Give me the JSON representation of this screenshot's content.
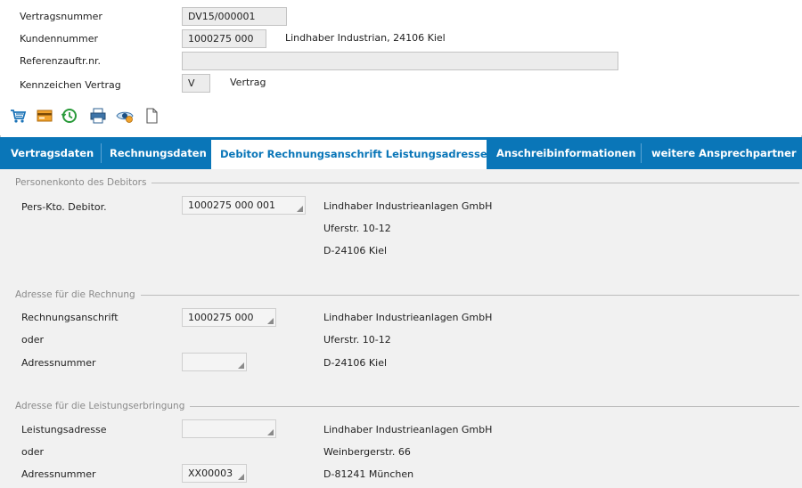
{
  "header": {
    "rows": [
      {
        "label": "Vertragsnummer",
        "value": "DV15/000001"
      },
      {
        "label": "Kundennummer",
        "value": "1000275 000",
        "extra": "Lindhaber Industrian, 24106 Kiel"
      },
      {
        "label": "Referenzauftr.nr.",
        "value": ""
      },
      {
        "label": "Kennzeichen Vertrag",
        "value": "V",
        "extra": "Vertrag"
      }
    ]
  },
  "toolbar": {
    "icons": [
      "cart-icon",
      "card-icon",
      "history-icon",
      "print-icon",
      "view-icon",
      "document-icon"
    ]
  },
  "tabs": [
    {
      "label": "Vertragsdaten",
      "active": false
    },
    {
      "label": "Rechnungsdaten",
      "active": false
    },
    {
      "label": "Debitor Rechnungsanschrift Leistungsadresse",
      "active": true
    },
    {
      "label": "Anschreibinformationen",
      "active": false
    },
    {
      "label": "weitere Ansprechpartner",
      "active": false
    }
  ],
  "groups": {
    "debitor": {
      "title": "Personenkonto des Debitors",
      "label": "Pers-Kto. Debitor.",
      "value": "1000275 000 001",
      "address": [
        "Lindhaber Industrieanlagen GmbH",
        "Uferstr. 10-12",
        "D-24106 Kiel"
      ]
    },
    "rechnung": {
      "title": "Adresse für die Rechnung",
      "rows": [
        {
          "label": "Rechnungsanschrift",
          "value": "1000275 000"
        },
        {
          "label": "oder"
        },
        {
          "label": "Adressnummer",
          "value": ""
        }
      ],
      "address": [
        "Lindhaber Industrieanlagen GmbH",
        "Uferstr. 10-12",
        "D-24106 Kiel"
      ]
    },
    "leistung": {
      "title": "Adresse für die Leistungserbringung",
      "rows": [
        {
          "label": "Leistungsadresse",
          "value": ""
        },
        {
          "label": "oder"
        },
        {
          "label": "Adressnummer",
          "value": "XX00003"
        }
      ],
      "address": [
        "Lindhaber Industrieanlagen GmbH",
        "Weinbergerstr. 66",
        "D-81241 München"
      ]
    }
  },
  "colors": {
    "tab_bg": "#0a76b8",
    "tab_active_text": "#0a76b8",
    "content_bg": "#f1f1f1"
  }
}
